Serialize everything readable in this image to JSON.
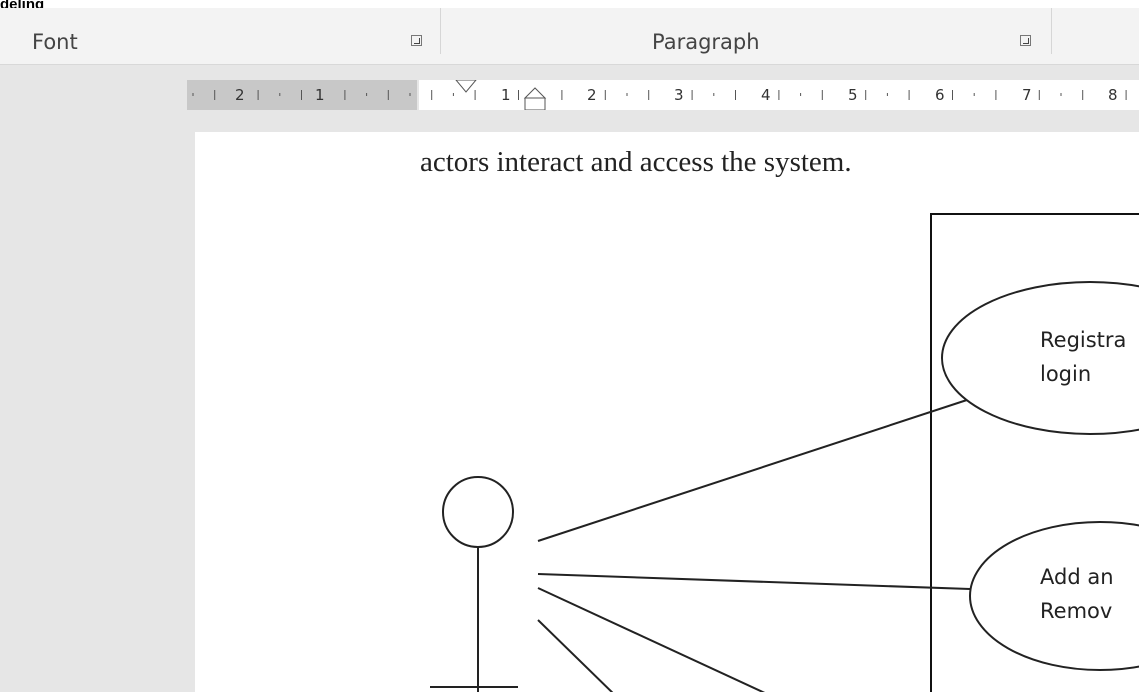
{
  "window": {
    "top_label": "deling"
  },
  "ribbon": {
    "groups": [
      {
        "label": "Font"
      },
      {
        "label": "Paragraph"
      }
    ]
  },
  "ruler": {
    "left_numbers": [
      "2",
      "1"
    ],
    "right_numbers": [
      "1",
      "2",
      "3",
      "4",
      "5",
      "6",
      "7",
      "8"
    ]
  },
  "document": {
    "text_line": "actors interact and access the system.",
    "use_cases": [
      {
        "line1": "Registra",
        "line2": "login"
      },
      {
        "line1": "Add an",
        "line2": "Remov"
      }
    ]
  }
}
